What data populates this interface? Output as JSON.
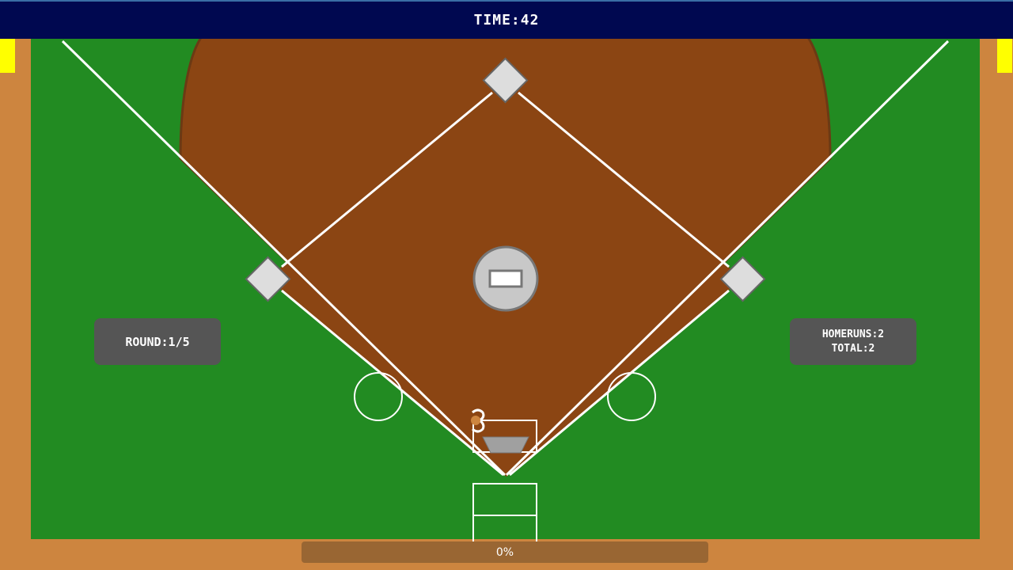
{
  "hud": {
    "time_text": "TIME:42",
    "round_text": "ROUND:1/5",
    "homeruns_text": "HOMERUNS:2",
    "total_text": "TOTAL:2"
  },
  "power_meter": {
    "percent": 0,
    "label": "0%"
  },
  "colors": {
    "wall": "#CD853F",
    "grass": "#228B22",
    "infield_dirt": "#8B4513",
    "topbar": "#000850",
    "yellow_marker": "#FFFF00",
    "panel": "#555555",
    "progress_track": "#996633"
  },
  "icons": {
    "pitcher": "pitcher-mound-icon",
    "bases": "base-icon",
    "batter": "batter-icon",
    "ball": "baseball-icon"
  }
}
